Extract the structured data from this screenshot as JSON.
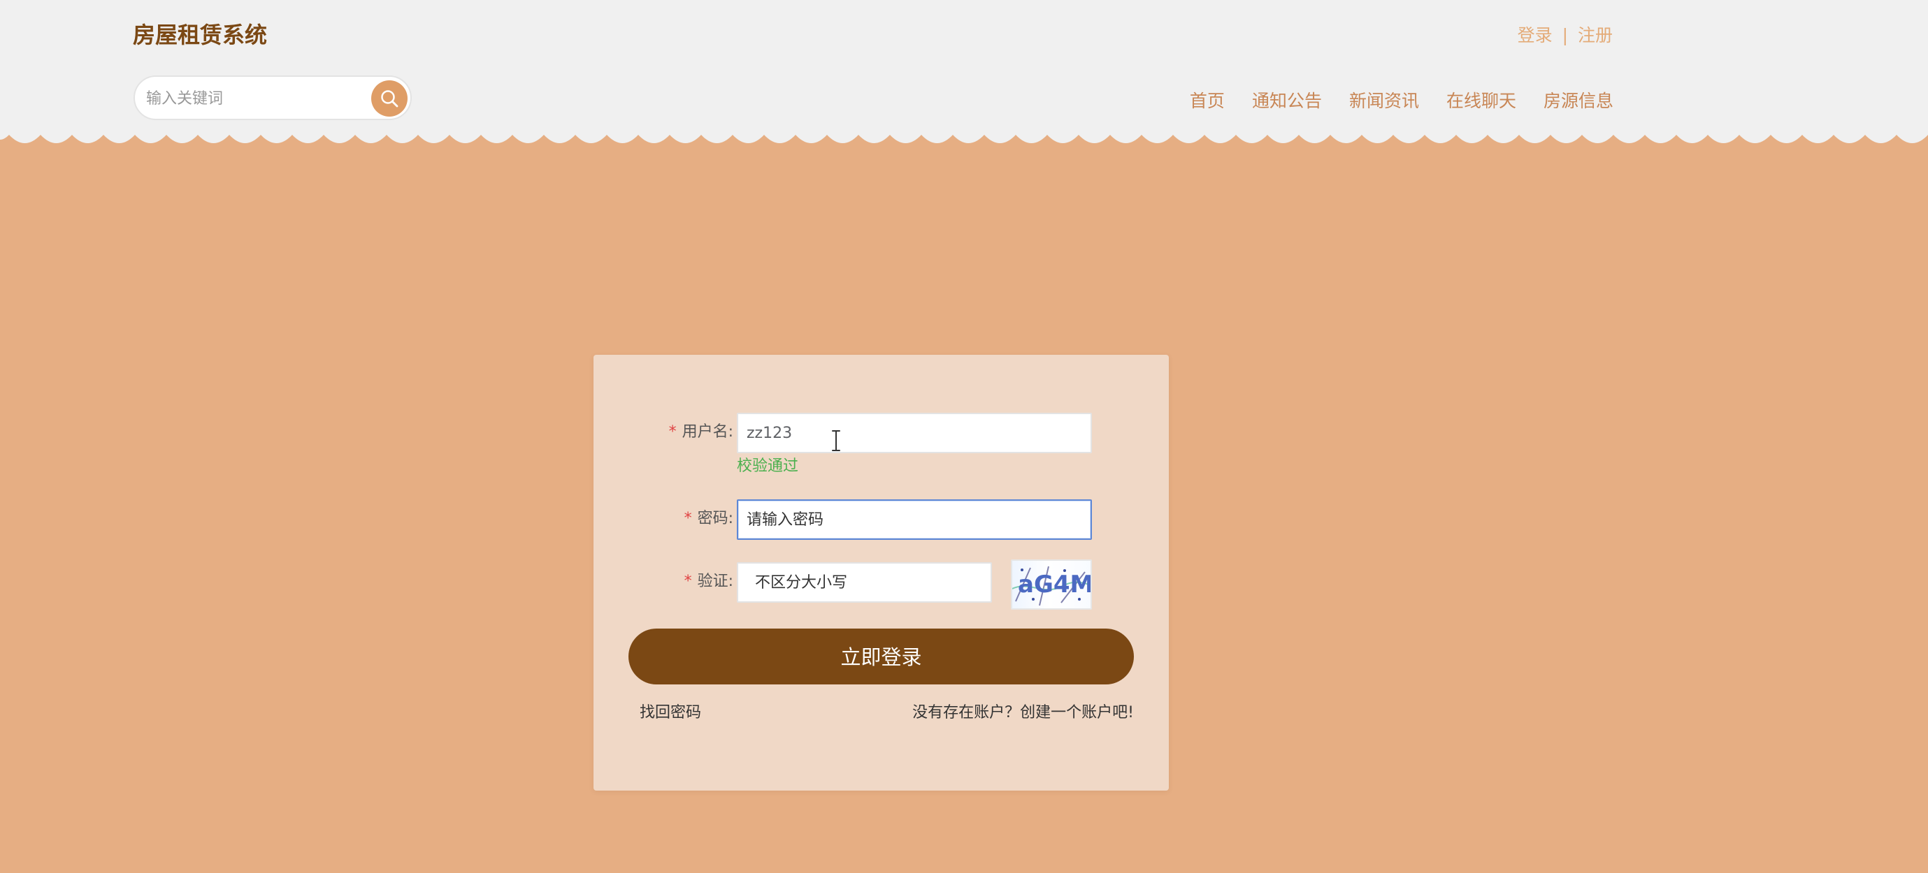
{
  "header": {
    "site_title": "房屋租赁系统",
    "auth": {
      "login": "登录",
      "separator": "|",
      "register": "注册"
    },
    "search": {
      "placeholder": "输入关键词",
      "value": "",
      "icon": "search-icon"
    },
    "nav": [
      {
        "label": "首页"
      },
      {
        "label": "通知公告"
      },
      {
        "label": "新闻资讯"
      },
      {
        "label": "在线聊天"
      },
      {
        "label": "房源信息"
      }
    ]
  },
  "login_form": {
    "required_marker": "*",
    "username": {
      "label": "用户名:",
      "value": "zz123",
      "validation": "校验通过"
    },
    "password": {
      "label": "密码:",
      "value": "",
      "placeholder": "请输入密码"
    },
    "captcha": {
      "label": "验证:",
      "value": "",
      "placeholder": "不区分大小写",
      "image_text": "aG4M"
    },
    "submit_label": "立即登录",
    "forgot_password": "找回密码",
    "register_prompt": "没有存在账户？创建一个账户吧!"
  },
  "colors": {
    "page_background": "#e6ae83",
    "header_background": "#f0f0f0",
    "brand_brown": "#7b4814",
    "nav_orange": "#c88655",
    "validation_green": "#4bb04f",
    "required_red": "#e04343",
    "focus_blue": "#5d87d6"
  }
}
